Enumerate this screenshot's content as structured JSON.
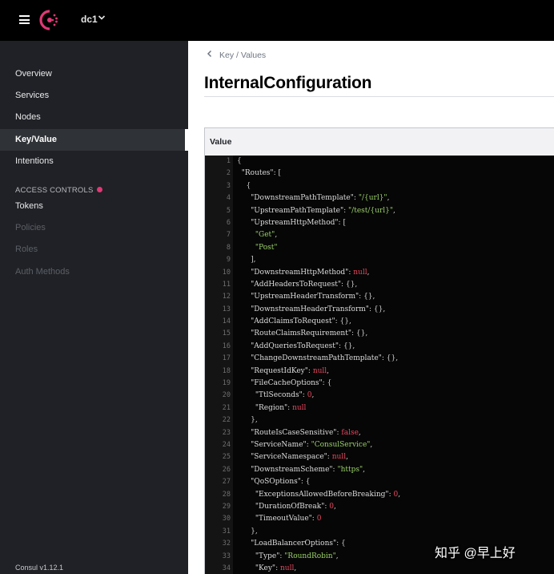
{
  "header": {
    "datacenter": "dc1",
    "icons": [
      "menu-icon",
      "consul-logo-icon",
      "chevron-down-icon"
    ]
  },
  "sidebar": {
    "items": [
      {
        "label": "Overview",
        "state": "normal"
      },
      {
        "label": "Services",
        "state": "normal"
      },
      {
        "label": "Nodes",
        "state": "normal"
      },
      {
        "label": "Key/Value",
        "state": "active"
      },
      {
        "label": "Intentions",
        "state": "normal"
      }
    ],
    "access_controls": {
      "heading": "ACCESS CONTROLS",
      "items": [
        {
          "label": "Tokens",
          "state": "normal"
        },
        {
          "label": "Policies",
          "state": "disabled"
        },
        {
          "label": "Roles",
          "state": "disabled"
        },
        {
          "label": "Auth Methods",
          "state": "disabled"
        }
      ]
    },
    "version": "Consul v1.12.1"
  },
  "main": {
    "breadcrumb": "Key / Values",
    "title": "InternalConfiguration",
    "value_label": "Value",
    "code_lines": [
      "{",
      "  \"Routes\": [",
      "    {",
      "      \"DownstreamPathTemplate\": \"/{url}\",",
      "      \"UpstreamPathTemplate\": \"/test/{url}\",",
      "      \"UpstreamHttpMethod\": [",
      "        \"Get\",",
      "        \"Post\"",
      "      ],",
      "      \"DownstreamHttpMethod\": null,",
      "      \"AddHeadersToRequest\": {},",
      "      \"UpstreamHeaderTransform\": {},",
      "      \"DownstreamHeaderTransform\": {},",
      "      \"AddClaimsToRequest\": {},",
      "      \"RouteClaimsRequirement\": {},",
      "      \"AddQueriesToRequest\": {},",
      "      \"ChangeDownstreamPathTemplate\": {},",
      "      \"RequestIdKey\": null,",
      "      \"FileCacheOptions\": {",
      "        \"TtlSeconds\": 0,",
      "        \"Region\": null",
      "      },",
      "      \"RouteIsCaseSensitive\": false,",
      "      \"ServiceName\": \"ConsulService\",",
      "      \"ServiceNamespace\": null,",
      "      \"DownstreamScheme\": \"https\",",
      "      \"QoSOptions\": {",
      "        \"ExceptionsAllowedBeforeBreaking\": 0,",
      "        \"DurationOfBreak\": 0,",
      "        \"TimeoutValue\": 0",
      "      },",
      "      \"LoadBalancerOptions\": {",
      "        \"Type\": \"RoundRobin\",",
      "        \"Key\": null,"
    ]
  },
  "watermark": "知乎 @早上好",
  "colors": {
    "topbar": "#000000",
    "sidebar": "#1f2126",
    "accent": "#e03875",
    "code_key": "#dedede",
    "code_string": "#9bd06a",
    "code_literal": "#e8475f"
  }
}
